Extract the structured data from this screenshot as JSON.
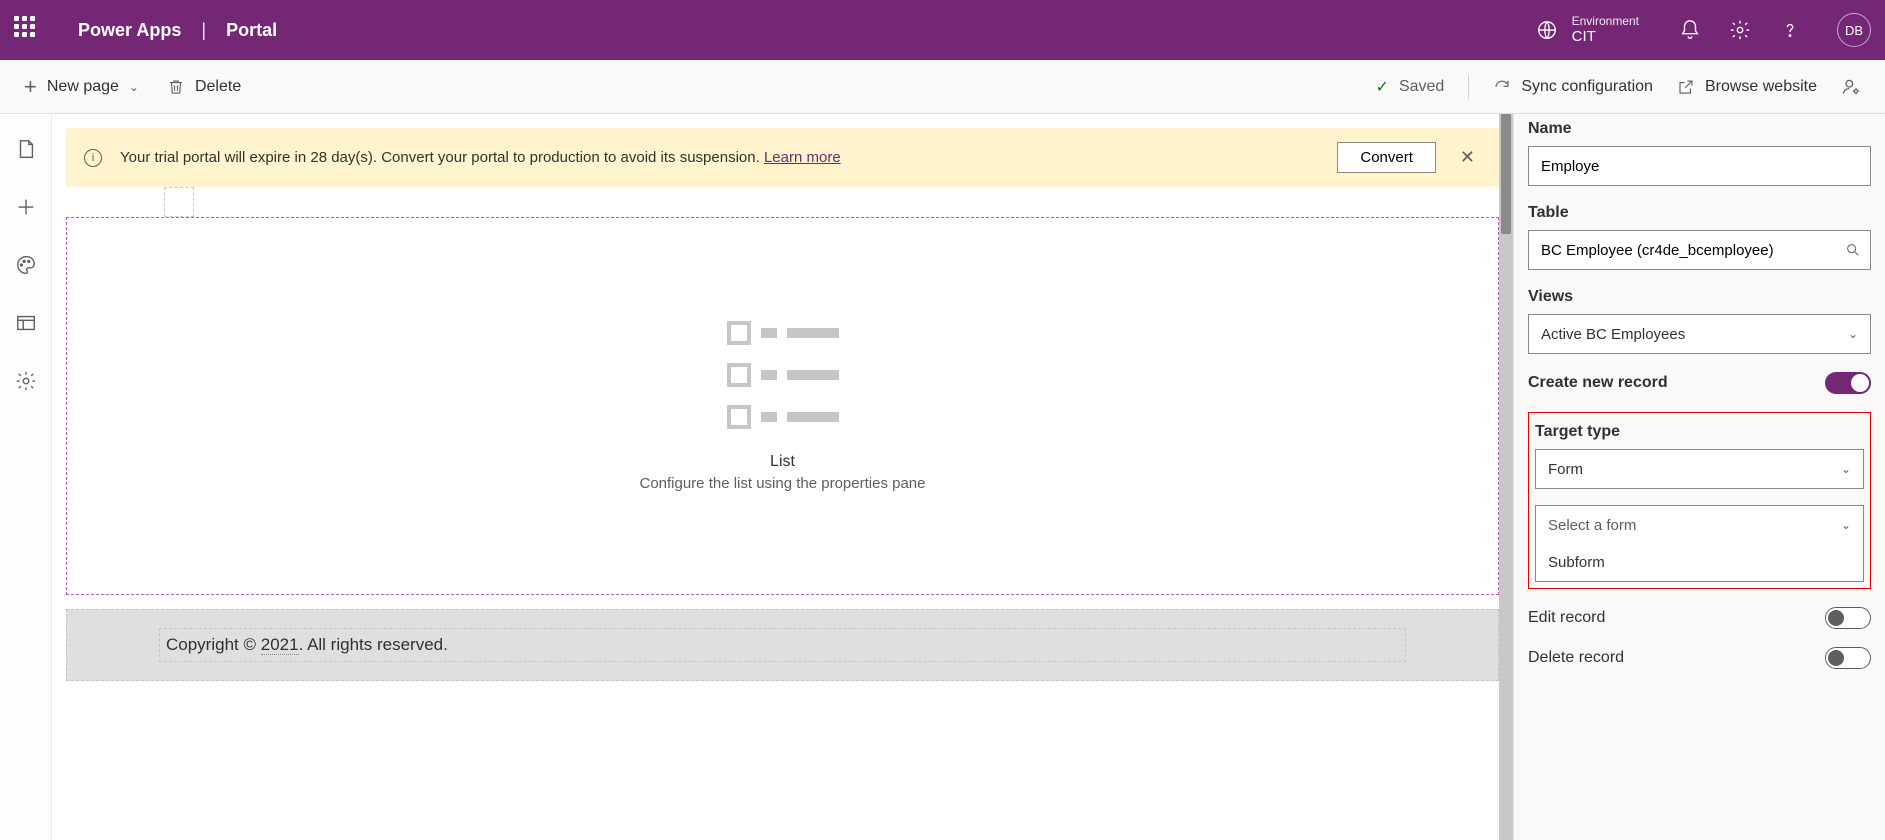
{
  "header": {
    "brand": "Power Apps",
    "section": "Portal",
    "env_label": "Environment",
    "env_name": "CIT",
    "avatar": "DB"
  },
  "cmdbar": {
    "new_page": "New page",
    "delete": "Delete",
    "saved": "Saved",
    "sync": "Sync configuration",
    "browse": "Browse website"
  },
  "banner": {
    "text": "Your trial portal will expire in 28 day(s). Convert your portal to production to avoid its suspension. ",
    "link": "Learn more",
    "button": "Convert"
  },
  "list_placeholder": {
    "title": "List",
    "subtitle": "Configure the list using the properties pane"
  },
  "footer": {
    "prefix": "Copyright © ",
    "year": "2021",
    "suffix": ". All rights reserved."
  },
  "props": {
    "name_label": "Name",
    "name_value": "Employe",
    "table_label": "Table",
    "table_value": "BC Employee (cr4de_bcemployee)",
    "views_label": "Views",
    "views_value": "Active BC Employees",
    "create_label": "Create new record",
    "target_label": "Target type",
    "target_value": "Form",
    "form_placeholder": "Select a form",
    "form_option": "Subform",
    "edit_label": "Edit record",
    "delete_label": "Delete record"
  }
}
